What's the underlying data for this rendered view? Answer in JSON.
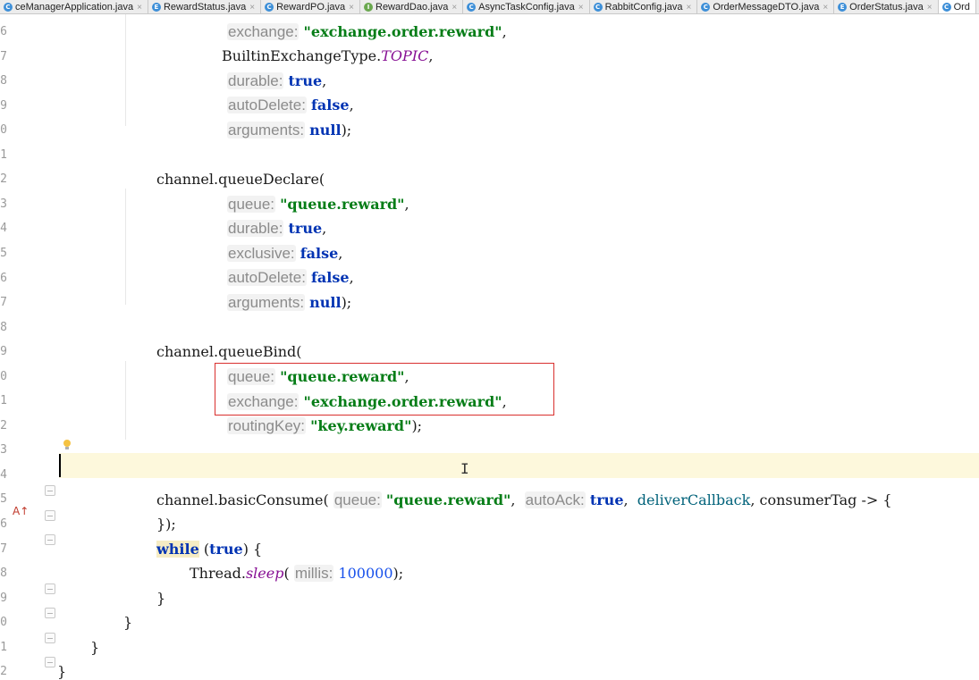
{
  "tabs": [
    {
      "icon": "c",
      "label": "ceManagerApplication.java",
      "active": false
    },
    {
      "icon": "e",
      "label": "RewardStatus.java",
      "active": false
    },
    {
      "icon": "c",
      "label": "RewardPO.java",
      "active": false
    },
    {
      "icon": "i",
      "label": "RewardDao.java",
      "active": false
    },
    {
      "icon": "c",
      "label": "AsyncTaskConfig.java",
      "active": false
    },
    {
      "icon": "c",
      "label": "RabbitConfig.java",
      "active": false
    },
    {
      "icon": "c",
      "label": "OrderMessageDTO.java",
      "active": false
    },
    {
      "icon": "e",
      "label": "OrderStatus.java",
      "active": false
    },
    {
      "icon": "c",
      "label": "Ord",
      "active": true
    }
  ],
  "tab_close_glyph": "×",
  "gutter": {
    "line_numbers": [
      "6",
      "7",
      "8",
      "9",
      "0",
      "1",
      "2",
      "3",
      "4",
      "5",
      "6",
      "7",
      "8",
      "9",
      "0",
      "1",
      "2",
      "3",
      "4",
      "5",
      "6",
      "7",
      "8",
      "9",
      "0",
      "1",
      "2"
    ],
    "override_marker": "A↑"
  },
  "code": {
    "l1": {
      "hint": "exchange:",
      "str": "\"exchange.order.reward\"",
      "tail": ","
    },
    "l2": {
      "text": "BuiltinExchangeType.",
      "it": "TOPIC",
      "tail": ","
    },
    "l3": {
      "hint": "durable:",
      "kw": "true",
      "tail": ","
    },
    "l4": {
      "hint": "autoDelete:",
      "kw": "false",
      "tail": ","
    },
    "l5": {
      "hint": "arguments:",
      "kw": "null",
      "tail": ");"
    },
    "l7": {
      "text": "channel.queueDeclare("
    },
    "l8": {
      "hint": "queue:",
      "str": "\"queue.reward\"",
      "tail": ","
    },
    "l9": {
      "hint": "durable:",
      "kw": "true",
      "tail": ","
    },
    "l10": {
      "hint": "exclusive:",
      "kw": "false",
      "tail": ","
    },
    "l11": {
      "hint": "autoDelete:",
      "kw": "false",
      "tail": ","
    },
    "l12": {
      "hint": "arguments:",
      "kw": "null",
      "tail": ");"
    },
    "l14": {
      "text": "channel.queueBind("
    },
    "l15": {
      "hint": "queue:",
      "str": "\"queue.reward\"",
      "tail": ","
    },
    "l16": {
      "hint": "exchange:",
      "str": "\"exchange.order.reward\"",
      "tail": ","
    },
    "l17": {
      "hint": "routingKey:",
      "str": "\"key.reward\"",
      "tail": ");"
    },
    "l20": {
      "pre": "channel.basicConsume(",
      "hint1": "queue:",
      "str": "\"queue.reward\"",
      "mid": ", ",
      "hint2": "autoAck:",
      "kw": "true",
      "mid2": ", ",
      "fn": "deliverCallback",
      "tail": ", consumerTag -> {"
    },
    "l21": {
      "text": "});"
    },
    "l22": {
      "kw": "while",
      "mid": " (",
      "kw2": "true",
      "tail": ") {"
    },
    "l23": {
      "pre": "Thread.",
      "it": "sleep",
      "open": "(",
      "hint": "millis:",
      "num": "100000",
      "tail": ");"
    },
    "l24": {
      "text": "}"
    },
    "l25": {
      "text": "}"
    },
    "l26": {
      "text": "}"
    },
    "l27": {
      "text": "}"
    }
  }
}
